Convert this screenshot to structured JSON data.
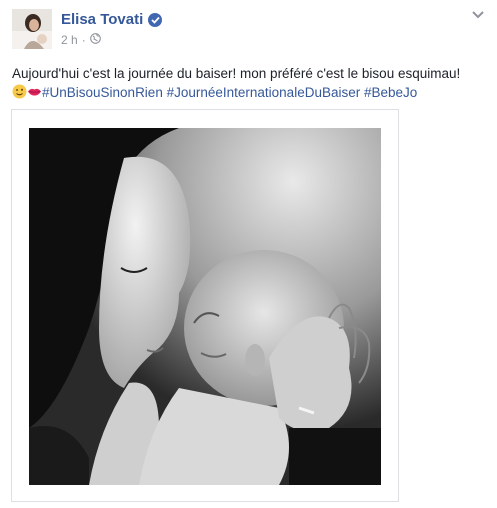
{
  "post": {
    "author_name": "Elisa Tovati",
    "verified": true,
    "timestamp": "2 h",
    "separator": "·",
    "privacy_icon": "globe-icon",
    "menu_icon": "chevron-down-icon",
    "text_line1": "Aujourd'hui c'est la journée du baiser! mon préféré c'est le bisou esquimau!",
    "emojis": [
      "wink-emoji-icon",
      "kiss-lips-emoji-icon"
    ],
    "hashtags": [
      "#UnBisouSinonRien",
      "#JournéeInternationaleDuBaiser",
      "#BebeJo"
    ],
    "photo": {
      "description_icon": "black-and-white-photo-of-mother-kissing-newborn",
      "style": "black-and-white"
    }
  },
  "colors": {
    "author_link": "#365899",
    "hashtag": "#365899",
    "verified_badge": "#4267b2",
    "meta_text": "#90949c",
    "body_text": "#1d2129",
    "border": "#dddfe2"
  }
}
